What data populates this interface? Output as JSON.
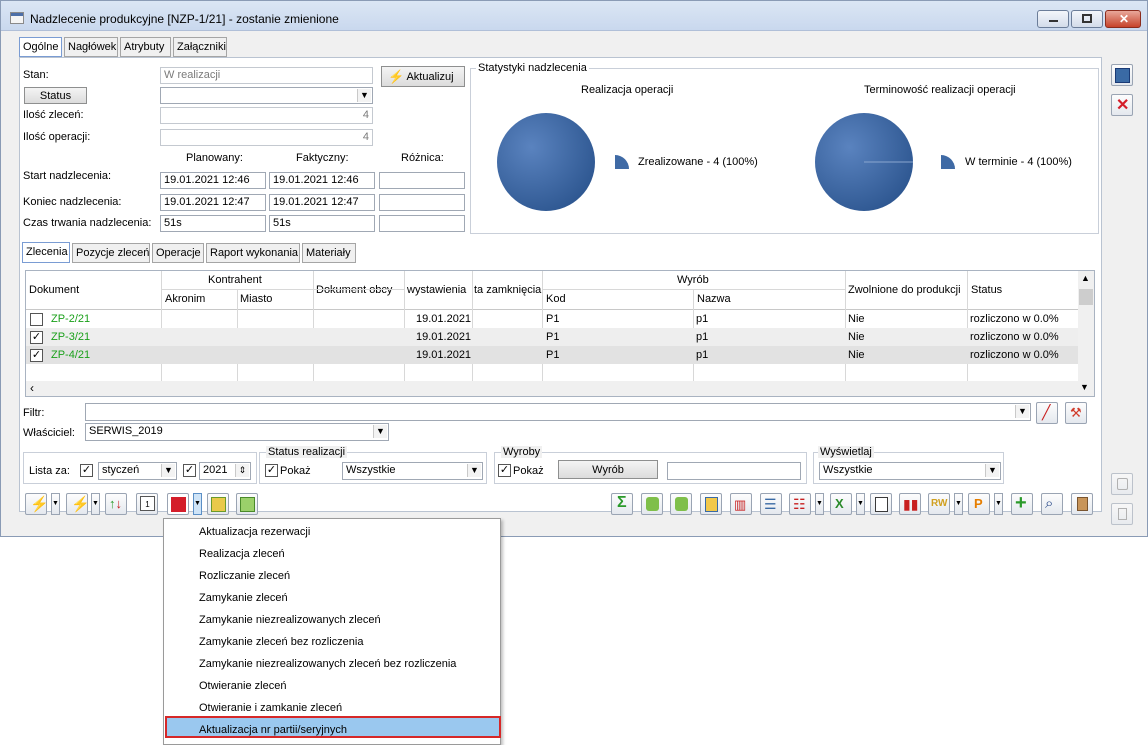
{
  "window": {
    "title": "Nadzlecenie produkcyjne [NZP-1/21] - zostanie zmienione"
  },
  "tabs": [
    "Ogólne",
    "Nagłówek",
    "Atrybuty",
    "Załączniki"
  ],
  "general": {
    "stan_label": "Stan:",
    "stan_value": "W realizacji",
    "aktualizuj_label": "Aktualizuj",
    "status_button": "Status",
    "ilosc_zlecen_label": "Ilość zleceń:",
    "ilosc_zlecen_value": "4",
    "ilosc_operacji_label": "Ilość operacji:",
    "ilosc_operacji_value": "4",
    "col_planowany": "Planowany:",
    "col_faktyczny": "Faktyczny:",
    "col_roznica": "Różnica:",
    "start_label": "Start nadzlecenia:",
    "start_planned": "19.01.2021 12:46",
    "start_actual": "19.01.2021 12:46",
    "koniec_label": "Koniec nadzlecenia:",
    "koniec_planned": "19.01.2021 12:47",
    "koniec_actual": "19.01.2021 12:47",
    "czas_label": "Czas trwania nadzlecenia:",
    "czas_planned": "51s",
    "czas_actual": "51s"
  },
  "stats": {
    "title": "Statystyki nadzlecenia",
    "chart1_title": "Realizacja operacji",
    "chart1_legend": "Zrealizowane - 4 (100%)",
    "chart2_title": "Terminowość realizacji operacji",
    "chart2_legend": "W terminie - 4 (100%)",
    "color": "#3f6aa5"
  },
  "subtabs": [
    "Zlecenia",
    "Pozycje zleceń",
    "Operacje",
    "Raport wykonania",
    "Materiały"
  ],
  "grid": {
    "headers": {
      "dokument": "Dokument",
      "kontrahent": "Kontrahent",
      "akronim": "Akronim",
      "miasto": "Miasto",
      "dokument_obcy": "Dokument obcy",
      "wystawienia": "wystawienia",
      "zamkniecia": "ta zamknięcia",
      "wyrob": "Wyrób",
      "kod": "Kod",
      "nazwa": "Nazwa",
      "zwolnione": "Zwolnione do produkcji",
      "status": "Status"
    },
    "rows": [
      {
        "checked": "",
        "doc": "ZP-2/21",
        "date": "19.01.2021",
        "kod": "P1",
        "nazwa": "p1",
        "zwolnione": "Nie",
        "status": "rozliczono w 0.0%"
      },
      {
        "checked": "✓",
        "doc": "ZP-3/21",
        "date": "19.01.2021",
        "kod": "P1",
        "nazwa": "p1",
        "zwolnione": "Nie",
        "status": "rozliczono w 0.0%"
      },
      {
        "checked": "✓",
        "doc": "ZP-4/21",
        "date": "19.01.2021",
        "kod": "P1",
        "nazwa": "p1",
        "zwolnione": "Nie",
        "status": "rozliczono w 0.0%"
      }
    ]
  },
  "filters": {
    "filtr_label": "Filtr:",
    "wlasciciel_label": "Właściciel:",
    "wlasciciel_value": "SERWIS_2019",
    "lista_za_label": "Lista za:",
    "month": "styczeń",
    "year": "2021",
    "status_real_title": "Status realizacji",
    "pokaz": "Pokaż",
    "status_value": "Wszystkie",
    "wyroby_title": "Wyroby",
    "wyrob_button": "Wyrób",
    "wyswietlaj_title": "Wyświetlaj",
    "wyswietlaj_value": "Wszystkie"
  },
  "menu": {
    "items": [
      "Aktualizacja rezerwacji",
      "Realizacja zleceń",
      "Rozliczanie zleceń",
      "Zamykanie zleceń",
      "Zamykanie niezrealizowanych zleceń",
      "Zamykanie zleceń bez rozliczenia",
      "Zamykanie niezrealizowanych zleceń bez rozliczenia",
      "Otwieranie zleceń",
      "Otwieranie i zamkanie zleceń",
      "Aktualizacja nr partii/seryjnych"
    ],
    "highlight_color": "#d62828"
  }
}
